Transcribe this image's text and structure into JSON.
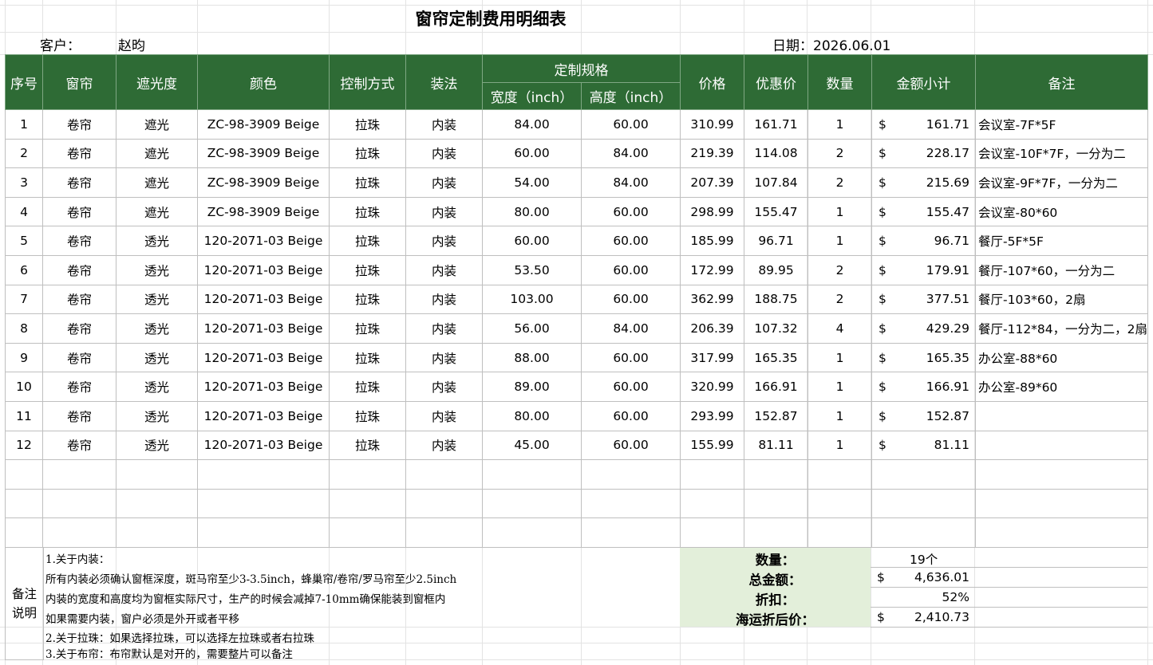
{
  "title": "窗帘定制费用明细表",
  "customer_label": "客户：",
  "customer_name": "赵昀",
  "date_text": "日期：2026.06.01",
  "headers": {
    "no": "序号",
    "type": "窗帘",
    "shading": "遮光度",
    "color": "颜色",
    "control": "控制方式",
    "install": "装法",
    "spec": "定制规格",
    "width": "宽度（inch）",
    "height": "高度（inch）",
    "price": "价格",
    "discount_price": "优惠价",
    "qty": "数量",
    "subtotal": "金额小计",
    "remark": "备注"
  },
  "currency": "$",
  "rows": [
    {
      "no": "1",
      "type": "卷帘",
      "shading": "遮光",
      "color": "ZC-98-3909 Beige",
      "control": "拉珠",
      "install": "内装",
      "width": "84.00",
      "height": "60.00",
      "price": "310.99",
      "dprice": "161.71",
      "qty": "1",
      "subtotal": "161.71",
      "remark": "会议室-7F*5F"
    },
    {
      "no": "2",
      "type": "卷帘",
      "shading": "遮光",
      "color": "ZC-98-3909 Beige",
      "control": "拉珠",
      "install": "内装",
      "width": "60.00",
      "height": "84.00",
      "price": "219.39",
      "dprice": "114.08",
      "qty": "2",
      "subtotal": "228.17",
      "remark": "会议室-10F*7F，一分为二"
    },
    {
      "no": "3",
      "type": "卷帘",
      "shading": "遮光",
      "color": "ZC-98-3909 Beige",
      "control": "拉珠",
      "install": "内装",
      "width": "54.00",
      "height": "84.00",
      "price": "207.39",
      "dprice": "107.84",
      "qty": "2",
      "subtotal": "215.69",
      "remark": "会议室-9F*7F，一分为二"
    },
    {
      "no": "4",
      "type": "卷帘",
      "shading": "遮光",
      "color": "ZC-98-3909 Beige",
      "control": "拉珠",
      "install": "内装",
      "width": "80.00",
      "height": "60.00",
      "price": "298.99",
      "dprice": "155.47",
      "qty": "1",
      "subtotal": "155.47",
      "remark": "会议室-80*60"
    },
    {
      "no": "5",
      "type": "卷帘",
      "shading": "透光",
      "color": "120-2071-03 Beige",
      "control": "拉珠",
      "install": "内装",
      "width": "60.00",
      "height": "60.00",
      "price": "185.99",
      "dprice": "96.71",
      "qty": "1",
      "subtotal": "96.71",
      "remark": "餐厅-5F*5F"
    },
    {
      "no": "6",
      "type": "卷帘",
      "shading": "透光",
      "color": "120-2071-03 Beige",
      "control": "拉珠",
      "install": "内装",
      "width": "53.50",
      "height": "60.00",
      "price": "172.99",
      "dprice": "89.95",
      "qty": "2",
      "subtotal": "179.91",
      "remark": "餐厅-107*60，一分为二"
    },
    {
      "no": "7",
      "type": "卷帘",
      "shading": "透光",
      "color": "120-2071-03 Beige",
      "control": "拉珠",
      "install": "内装",
      "width": "103.00",
      "height": "60.00",
      "price": "362.99",
      "dprice": "188.75",
      "qty": "2",
      "subtotal": "377.51",
      "remark": "餐厅-103*60，2扇"
    },
    {
      "no": "8",
      "type": "卷帘",
      "shading": "透光",
      "color": "120-2071-03 Beige",
      "control": "拉珠",
      "install": "内装",
      "width": "56.00",
      "height": "84.00",
      "price": "206.39",
      "dprice": "107.32",
      "qty": "4",
      "subtotal": "429.29",
      "remark": "餐厅-112*84，一分为二，2扇"
    },
    {
      "no": "9",
      "type": "卷帘",
      "shading": "透光",
      "color": "120-2071-03 Beige",
      "control": "拉珠",
      "install": "内装",
      "width": "88.00",
      "height": "60.00",
      "price": "317.99",
      "dprice": "165.35",
      "qty": "1",
      "subtotal": "165.35",
      "remark": "办公室-88*60"
    },
    {
      "no": "10",
      "type": "卷帘",
      "shading": "透光",
      "color": "120-2071-03 Beige",
      "control": "拉珠",
      "install": "内装",
      "width": "89.00",
      "height": "60.00",
      "price": "320.99",
      "dprice": "166.91",
      "qty": "1",
      "subtotal": "166.91",
      "remark": "办公室-89*60"
    },
    {
      "no": "11",
      "type": "卷帘",
      "shading": "透光",
      "color": "120-2071-03 Beige",
      "control": "拉珠",
      "install": "内装",
      "width": "80.00",
      "height": "60.00",
      "price": "293.99",
      "dprice": "152.87",
      "qty": "1",
      "subtotal": "152.87",
      "remark": ""
    },
    {
      "no": "12",
      "type": "卷帘",
      "shading": "透光",
      "color": "120-2071-03 Beige",
      "control": "拉珠",
      "install": "内装",
      "width": "45.00",
      "height": "60.00",
      "price": "155.99",
      "dprice": "81.11",
      "qty": "1",
      "subtotal": "81.11",
      "remark": ""
    }
  ],
  "empty_rows": 3,
  "remarks_label_line1": "备注",
  "remarks_label_line2": "说明",
  "notes": [
    "1.关于内装：",
    "所有内装必须确认窗框深度，斑马帘至少3-3.5inch，蜂巢帘/卷帘/罗马帘至少2.5inch",
    "内装的宽度和高度均为窗框实际尺寸，生产的时候会减掉7-10mm确保能装到窗框内",
    "如果需要内装，窗户必须是外开或者平移",
    "2.关于拉珠：如果选择拉珠，可以选择左拉珠或者右拉珠",
    "3.关于布帘：布帘默认是对开的，需要整片可以备注"
  ],
  "summary": {
    "qty_label": "数量：",
    "qty_value": "19个",
    "total_label": "总金额：",
    "total_value": "4,636.01",
    "discount_label": "折扣：",
    "discount_value": "52%",
    "final_label": "海运折后价：",
    "final_value": "2,410.73"
  },
  "colors": {
    "header_green": "#2e6b35",
    "summary_green": "#e3efda"
  }
}
